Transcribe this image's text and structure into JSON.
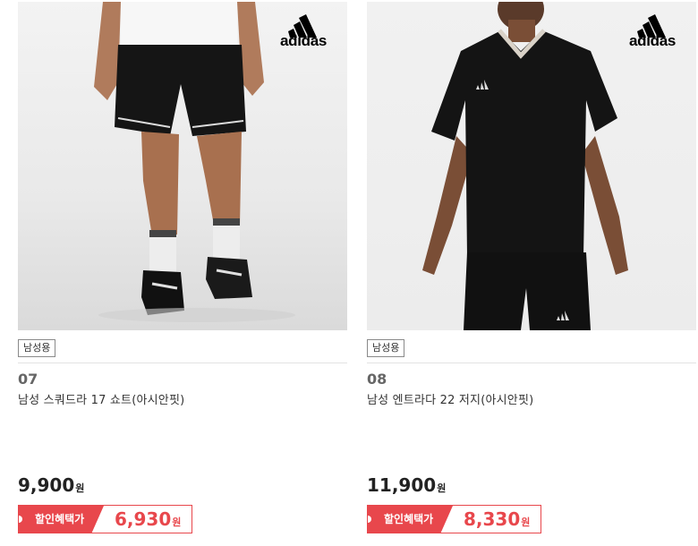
{
  "products": [
    {
      "brand": "adidas",
      "tag": "남성용",
      "number": "07",
      "name": "남성 스쿼드라 17 쇼트(아시안핏)",
      "price": "9,900",
      "price_unit": "원",
      "discount_label": "할인혜택가",
      "discount_price": "6,930",
      "discount_unit": "원"
    },
    {
      "brand": "adidas",
      "tag": "남성용",
      "number": "08",
      "name": "남성 엔트라다 22 저지(아시안핏)",
      "price": "11,900",
      "price_unit": "원",
      "discount_label": "할인혜택가",
      "discount_price": "8,330",
      "discount_unit": "원"
    }
  ],
  "colors": {
    "accent": "#e8474c",
    "text": "#222222",
    "muted": "#666666"
  }
}
